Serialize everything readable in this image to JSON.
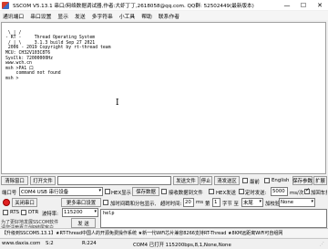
{
  "window": {
    "title": "SSCOM V5.13.1 串口/网络数据调试器,作者:大虾丁丁,2618058@qq.com. QQ群: 52502449(最新版本)",
    "minimize": "—",
    "maximize": "☐",
    "close": "✕"
  },
  "menu": [
    "通讯端口",
    "串口设置",
    "显示",
    "发送",
    "多字符串",
    "小工具",
    "帮助",
    "联系作者"
  ],
  "terminal": {
    "lines": [
      " \\ | /",
      "- RT -     Thread Operating System",
      " / | \\     3.1.3 build Sep 27 2021",
      " 2006 - 2019 Copyright by rt-thread team",
      "",
      "MCU: CH32V103C8T6",
      "SysClk: 72000000Hz",
      "www.wch.cn",
      "msh >PA1 口",
      "    command not found",
      "msh >"
    ]
  },
  "row1": {
    "clear_window": "清除窗口",
    "open_file": "打开文件",
    "send_file": "发送文件",
    "stop": "停止",
    "clear_send": "清发送区",
    "topmost": "最前",
    "english": "English",
    "save_params": "保存参数",
    "expand": "扩展"
  },
  "row2": {
    "port_label": "端口号",
    "port_value": "COM4 USB 串行设备",
    "hex_display": "HEX显示",
    "save_data": "保存数据",
    "recv_to_file": "接收数据到文件",
    "hex_send": "HEX发送",
    "timed_send": "定时发送:",
    "interval": "5000",
    "interval_unit": "ms/次",
    "add_enter": "加回车换行"
  },
  "row3": {
    "close_port": "关闭串口",
    "more_settings": "更多串口设置",
    "timestamp": "加时间戳和分包显示,",
    "timeout_label": "超时时间:",
    "timeout_value": "20",
    "timeout_unit": "ms",
    "index_label": "第",
    "index_value": "1",
    "byte_label": "字节 至",
    "checksum_value": "末尾",
    "verify_label": "加校验",
    "verify_value": "None"
  },
  "row4": {
    "rts": "RTS",
    "dtr": "DTR",
    "baud_label": "波特率:",
    "baud_value": "115200",
    "send_text": "help"
  },
  "notice": {
    "line1": "为了更好地发展SSCOM软件",
    "line2": "请您注册嘉立创P结尾客户",
    "send_button": "发  送"
  },
  "marquee": "【升级到SSCOM5.13.1】★RT-Thread中国人的开源免费操作系统 ★新一代WiFi芯片兼容8266支持RT-Thread ★8KM远距离WiFi可自组网",
  "status": {
    "site": "www.daxia.com",
    "s": "S:2",
    "r": "R:224",
    "port_state": "COM4 已打开  115200bps,8,1,None,None"
  }
}
